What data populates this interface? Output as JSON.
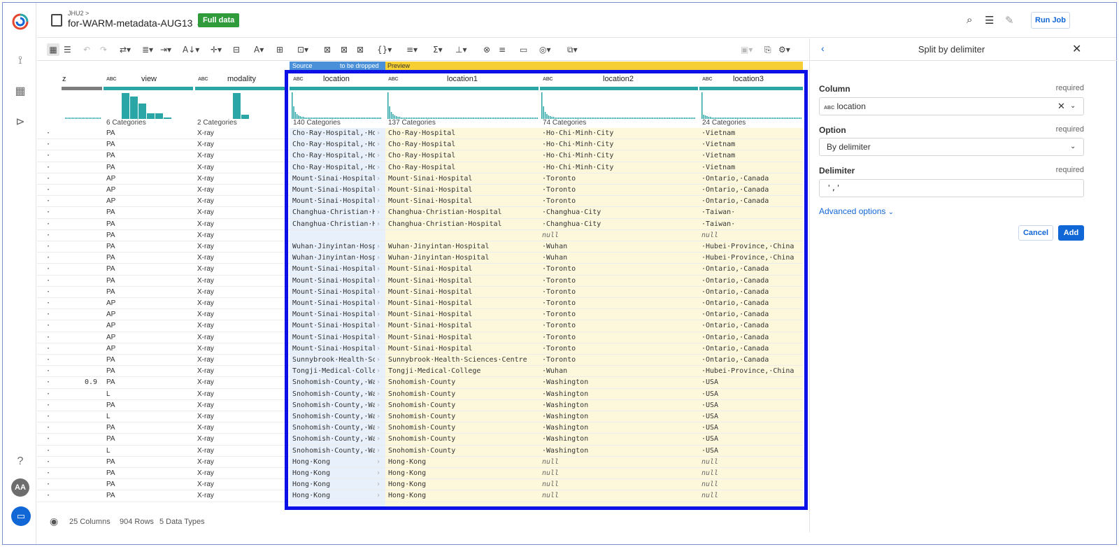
{
  "header": {
    "breadcrumb": "JHU2 >",
    "dataset_title": "for-WARM-metadata-AUG13",
    "title_chevron": "⌄",
    "badge": "Full data",
    "run_job": "Run Job"
  },
  "grid": {
    "source_strip": "Source",
    "dropped_strip": "to be dropped",
    "preview_strip": "Preview",
    "type_tag": "ABC",
    "col_trunc": {
      "name": "z",
      "rows": [
        "",
        "",
        "",
        "",
        "",
        "",
        "",
        "",
        "",
        "",
        "",
        "",
        "",
        "",
        "",
        "",
        "",
        "",
        "",
        "",
        "",
        "",
        "0.9",
        "",
        "",
        "",
        "",
        "",
        "",
        "",
        "",
        "",
        ""
      ]
    },
    "col_view": {
      "name": "view",
      "cats": "6 Categories"
    },
    "col_modality": {
      "name": "modality",
      "cats": "2 Categories"
    },
    "col_location": {
      "name": "location",
      "cats": "140 Categories"
    },
    "col_location1": {
      "name": "location1",
      "cats": "137 Categories"
    },
    "col_location2": {
      "name": "location2",
      "cats": "74 Categories"
    },
    "col_location3": {
      "name": "location3",
      "cats": "24 Categories"
    },
    "rows": [
      [
        "PA",
        "X-ray",
        "Cho·Ray·Hospital,·Ho·Chi",
        "Cho·Ray·Hospital",
        "·Ho·Chi·Minh·City",
        "·Vietnam"
      ],
      [
        "PA",
        "X-ray",
        "Cho·Ray·Hospital,·Ho·Chi",
        "Cho·Ray·Hospital",
        "·Ho·Chi·Minh·City",
        "·Vietnam"
      ],
      [
        "PA",
        "X-ray",
        "Cho·Ray·Hospital,·Ho·Chi",
        "Cho·Ray·Hospital",
        "·Ho·Chi·Minh·City",
        "·Vietnam"
      ],
      [
        "PA",
        "X-ray",
        "Cho·Ray·Hospital,·Ho·Chi",
        "Cho·Ray·Hospital",
        "·Ho·Chi·Minh·City",
        "·Vietnam"
      ],
      [
        "AP",
        "X-ray",
        "Mount·Sinai·Hospital,·To",
        "Mount·Sinai·Hospital",
        "·Toronto",
        "·Ontario,·Canada"
      ],
      [
        "AP",
        "X-ray",
        "Mount·Sinai·Hospital,·To",
        "Mount·Sinai·Hospital",
        "·Toronto",
        "·Ontario,·Canada"
      ],
      [
        "AP",
        "X-ray",
        "Mount·Sinai·Hospital,·To",
        "Mount·Sinai·Hospital",
        "·Toronto",
        "·Ontario,·Canada"
      ],
      [
        "PA",
        "X-ray",
        "Changhua·Christian·Hosp",
        "Changhua·Christian·Hospital",
        "·Changhua·City",
        "·Taiwan·"
      ],
      [
        "PA",
        "X-ray",
        "Changhua·Christian·Hosp",
        "Changhua·Christian·Hospital",
        "·Changhua·City",
        "·Taiwan·"
      ],
      [
        "PA",
        "X-ray",
        "",
        "",
        "null",
        "null"
      ],
      [
        "PA",
        "X-ray",
        "Wuhan·Jinyintan·Hospital",
        "Wuhan·Jinyintan·Hospital",
        "·Wuhan",
        "·Hubei·Province,·China"
      ],
      [
        "PA",
        "X-ray",
        "Wuhan·Jinyintan·Hospital",
        "Wuhan·Jinyintan·Hospital",
        "·Wuhan",
        "·Hubei·Province,·China"
      ],
      [
        "PA",
        "X-ray",
        "Mount·Sinai·Hospital,·To",
        "Mount·Sinai·Hospital",
        "·Toronto",
        "·Ontario,·Canada"
      ],
      [
        "PA",
        "X-ray",
        "Mount·Sinai·Hospital,·To",
        "Mount·Sinai·Hospital",
        "·Toronto",
        "·Ontario,·Canada"
      ],
      [
        "PA",
        "X-ray",
        "Mount·Sinai·Hospital,·To",
        "Mount·Sinai·Hospital",
        "·Toronto",
        "·Ontario,·Canada"
      ],
      [
        "AP",
        "X-ray",
        "Mount·Sinai·Hospital,·To",
        "Mount·Sinai·Hospital",
        "·Toronto",
        "·Ontario,·Canada"
      ],
      [
        "AP",
        "X-ray",
        "Mount·Sinai·Hospital,·To",
        "Mount·Sinai·Hospital",
        "·Toronto",
        "·Ontario,·Canada"
      ],
      [
        "AP",
        "X-ray",
        "Mount·Sinai·Hospital,·To",
        "Mount·Sinai·Hospital",
        "·Toronto",
        "·Ontario,·Canada"
      ],
      [
        "AP",
        "X-ray",
        "Mount·Sinai·Hospital,·To",
        "Mount·Sinai·Hospital",
        "·Toronto",
        "·Ontario,·Canada"
      ],
      [
        "AP",
        "X-ray",
        "Mount·Sinai·Hospital,·To",
        "Mount·Sinai·Hospital",
        "·Toronto",
        "·Ontario,·Canada"
      ],
      [
        "PA",
        "X-ray",
        "Sunnybrook·Health·Scien",
        "Sunnybrook·Health·Sciences·Centre",
        "·Toronto",
        "·Ontario,·Canada"
      ],
      [
        "PA",
        "X-ray",
        "Tongji·Medical·College,·",
        "Tongji·Medical·College",
        "·Wuhan",
        "·Hubei·Province,·China"
      ],
      [
        "PA",
        "X-ray",
        "Snohomish·County,·Wash",
        "Snohomish·County",
        "·Washington",
        "·USA"
      ],
      [
        "L",
        "X-ray",
        "Snohomish·County,·Wash",
        "Snohomish·County",
        "·Washington",
        "·USA"
      ],
      [
        "PA",
        "X-ray",
        "Snohomish·County,·Wash",
        "Snohomish·County",
        "·Washington",
        "·USA"
      ],
      [
        "L",
        "X-ray",
        "Snohomish·County,·Wash",
        "Snohomish·County",
        "·Washington",
        "·USA"
      ],
      [
        "PA",
        "X-ray",
        "Snohomish·County,·Wash",
        "Snohomish·County",
        "·Washington",
        "·USA"
      ],
      [
        "PA",
        "X-ray",
        "Snohomish·County,·Wash",
        "Snohomish·County",
        "·Washington",
        "·USA"
      ],
      [
        "L",
        "X-ray",
        "Snohomish·County,·Wash",
        "Snohomish·County",
        "·Washington",
        "·USA"
      ],
      [
        "PA",
        "X-ray",
        "Hong·Kong",
        "Hong·Kong",
        "null",
        "null"
      ],
      [
        "PA",
        "X-ray",
        "Hong·Kong",
        "Hong·Kong",
        "null",
        "null"
      ],
      [
        "PA",
        "X-ray",
        "Hong·Kong",
        "Hong·Kong",
        "null",
        "null"
      ],
      [
        "PA",
        "X-ray",
        "Hong·Kong",
        "Hong·Kong",
        "null",
        "null"
      ]
    ]
  },
  "footer": {
    "columns": "25 Columns",
    "rows": "904 Rows",
    "types": "5 Data Types"
  },
  "panel": {
    "title": "Split by delimiter",
    "column_label": "Column",
    "column_required": "required",
    "column_value": "location",
    "option_label": "Option",
    "option_required": "required",
    "option_value": "By delimiter",
    "delimiter_label": "Delimiter",
    "delimiter_required": "required",
    "delimiter_value": "','",
    "advanced": "Advanced options",
    "cancel": "Cancel",
    "add": "Add"
  },
  "rail": {
    "avatar": "AA"
  },
  "colors": {
    "accent": "#1167d6",
    "badge": "#2f9b3a",
    "quality_bar": "#2aa6a6",
    "highlight_box": "#0a10e6",
    "preview_bg": "#fdf8dc",
    "source_bg": "#e8f1fb"
  }
}
